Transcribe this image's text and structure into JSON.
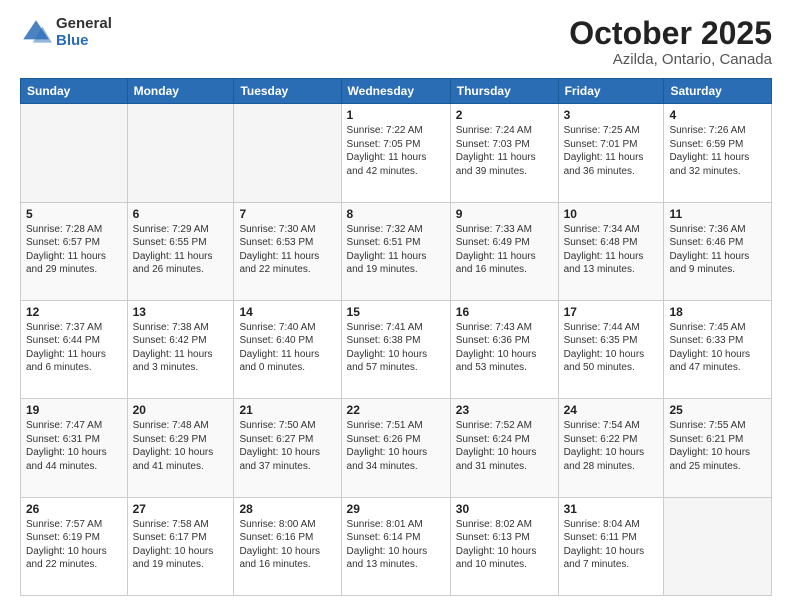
{
  "logo": {
    "general": "General",
    "blue": "Blue"
  },
  "calendar": {
    "title": "October 2025",
    "subtitle": "Azilda, Ontario, Canada",
    "days_of_week": [
      "Sunday",
      "Monday",
      "Tuesday",
      "Wednesday",
      "Thursday",
      "Friday",
      "Saturday"
    ],
    "weeks": [
      [
        {
          "num": "",
          "info": ""
        },
        {
          "num": "",
          "info": ""
        },
        {
          "num": "",
          "info": ""
        },
        {
          "num": "1",
          "info": "Sunrise: 7:22 AM\nSunset: 7:05 PM\nDaylight: 11 hours\nand 42 minutes."
        },
        {
          "num": "2",
          "info": "Sunrise: 7:24 AM\nSunset: 7:03 PM\nDaylight: 11 hours\nand 39 minutes."
        },
        {
          "num": "3",
          "info": "Sunrise: 7:25 AM\nSunset: 7:01 PM\nDaylight: 11 hours\nand 36 minutes."
        },
        {
          "num": "4",
          "info": "Sunrise: 7:26 AM\nSunset: 6:59 PM\nDaylight: 11 hours\nand 32 minutes."
        }
      ],
      [
        {
          "num": "5",
          "info": "Sunrise: 7:28 AM\nSunset: 6:57 PM\nDaylight: 11 hours\nand 29 minutes."
        },
        {
          "num": "6",
          "info": "Sunrise: 7:29 AM\nSunset: 6:55 PM\nDaylight: 11 hours\nand 26 minutes."
        },
        {
          "num": "7",
          "info": "Sunrise: 7:30 AM\nSunset: 6:53 PM\nDaylight: 11 hours\nand 22 minutes."
        },
        {
          "num": "8",
          "info": "Sunrise: 7:32 AM\nSunset: 6:51 PM\nDaylight: 11 hours\nand 19 minutes."
        },
        {
          "num": "9",
          "info": "Sunrise: 7:33 AM\nSunset: 6:49 PM\nDaylight: 11 hours\nand 16 minutes."
        },
        {
          "num": "10",
          "info": "Sunrise: 7:34 AM\nSunset: 6:48 PM\nDaylight: 11 hours\nand 13 minutes."
        },
        {
          "num": "11",
          "info": "Sunrise: 7:36 AM\nSunset: 6:46 PM\nDaylight: 11 hours\nand 9 minutes."
        }
      ],
      [
        {
          "num": "12",
          "info": "Sunrise: 7:37 AM\nSunset: 6:44 PM\nDaylight: 11 hours\nand 6 minutes."
        },
        {
          "num": "13",
          "info": "Sunrise: 7:38 AM\nSunset: 6:42 PM\nDaylight: 11 hours\nand 3 minutes."
        },
        {
          "num": "14",
          "info": "Sunrise: 7:40 AM\nSunset: 6:40 PM\nDaylight: 11 hours\nand 0 minutes."
        },
        {
          "num": "15",
          "info": "Sunrise: 7:41 AM\nSunset: 6:38 PM\nDaylight: 10 hours\nand 57 minutes."
        },
        {
          "num": "16",
          "info": "Sunrise: 7:43 AM\nSunset: 6:36 PM\nDaylight: 10 hours\nand 53 minutes."
        },
        {
          "num": "17",
          "info": "Sunrise: 7:44 AM\nSunset: 6:35 PM\nDaylight: 10 hours\nand 50 minutes."
        },
        {
          "num": "18",
          "info": "Sunrise: 7:45 AM\nSunset: 6:33 PM\nDaylight: 10 hours\nand 47 minutes."
        }
      ],
      [
        {
          "num": "19",
          "info": "Sunrise: 7:47 AM\nSunset: 6:31 PM\nDaylight: 10 hours\nand 44 minutes."
        },
        {
          "num": "20",
          "info": "Sunrise: 7:48 AM\nSunset: 6:29 PM\nDaylight: 10 hours\nand 41 minutes."
        },
        {
          "num": "21",
          "info": "Sunrise: 7:50 AM\nSunset: 6:27 PM\nDaylight: 10 hours\nand 37 minutes."
        },
        {
          "num": "22",
          "info": "Sunrise: 7:51 AM\nSunset: 6:26 PM\nDaylight: 10 hours\nand 34 minutes."
        },
        {
          "num": "23",
          "info": "Sunrise: 7:52 AM\nSunset: 6:24 PM\nDaylight: 10 hours\nand 31 minutes."
        },
        {
          "num": "24",
          "info": "Sunrise: 7:54 AM\nSunset: 6:22 PM\nDaylight: 10 hours\nand 28 minutes."
        },
        {
          "num": "25",
          "info": "Sunrise: 7:55 AM\nSunset: 6:21 PM\nDaylight: 10 hours\nand 25 minutes."
        }
      ],
      [
        {
          "num": "26",
          "info": "Sunrise: 7:57 AM\nSunset: 6:19 PM\nDaylight: 10 hours\nand 22 minutes."
        },
        {
          "num": "27",
          "info": "Sunrise: 7:58 AM\nSunset: 6:17 PM\nDaylight: 10 hours\nand 19 minutes."
        },
        {
          "num": "28",
          "info": "Sunrise: 8:00 AM\nSunset: 6:16 PM\nDaylight: 10 hours\nand 16 minutes."
        },
        {
          "num": "29",
          "info": "Sunrise: 8:01 AM\nSunset: 6:14 PM\nDaylight: 10 hours\nand 13 minutes."
        },
        {
          "num": "30",
          "info": "Sunrise: 8:02 AM\nSunset: 6:13 PM\nDaylight: 10 hours\nand 10 minutes."
        },
        {
          "num": "31",
          "info": "Sunrise: 8:04 AM\nSunset: 6:11 PM\nDaylight: 10 hours\nand 7 minutes."
        },
        {
          "num": "",
          "info": ""
        }
      ]
    ]
  }
}
